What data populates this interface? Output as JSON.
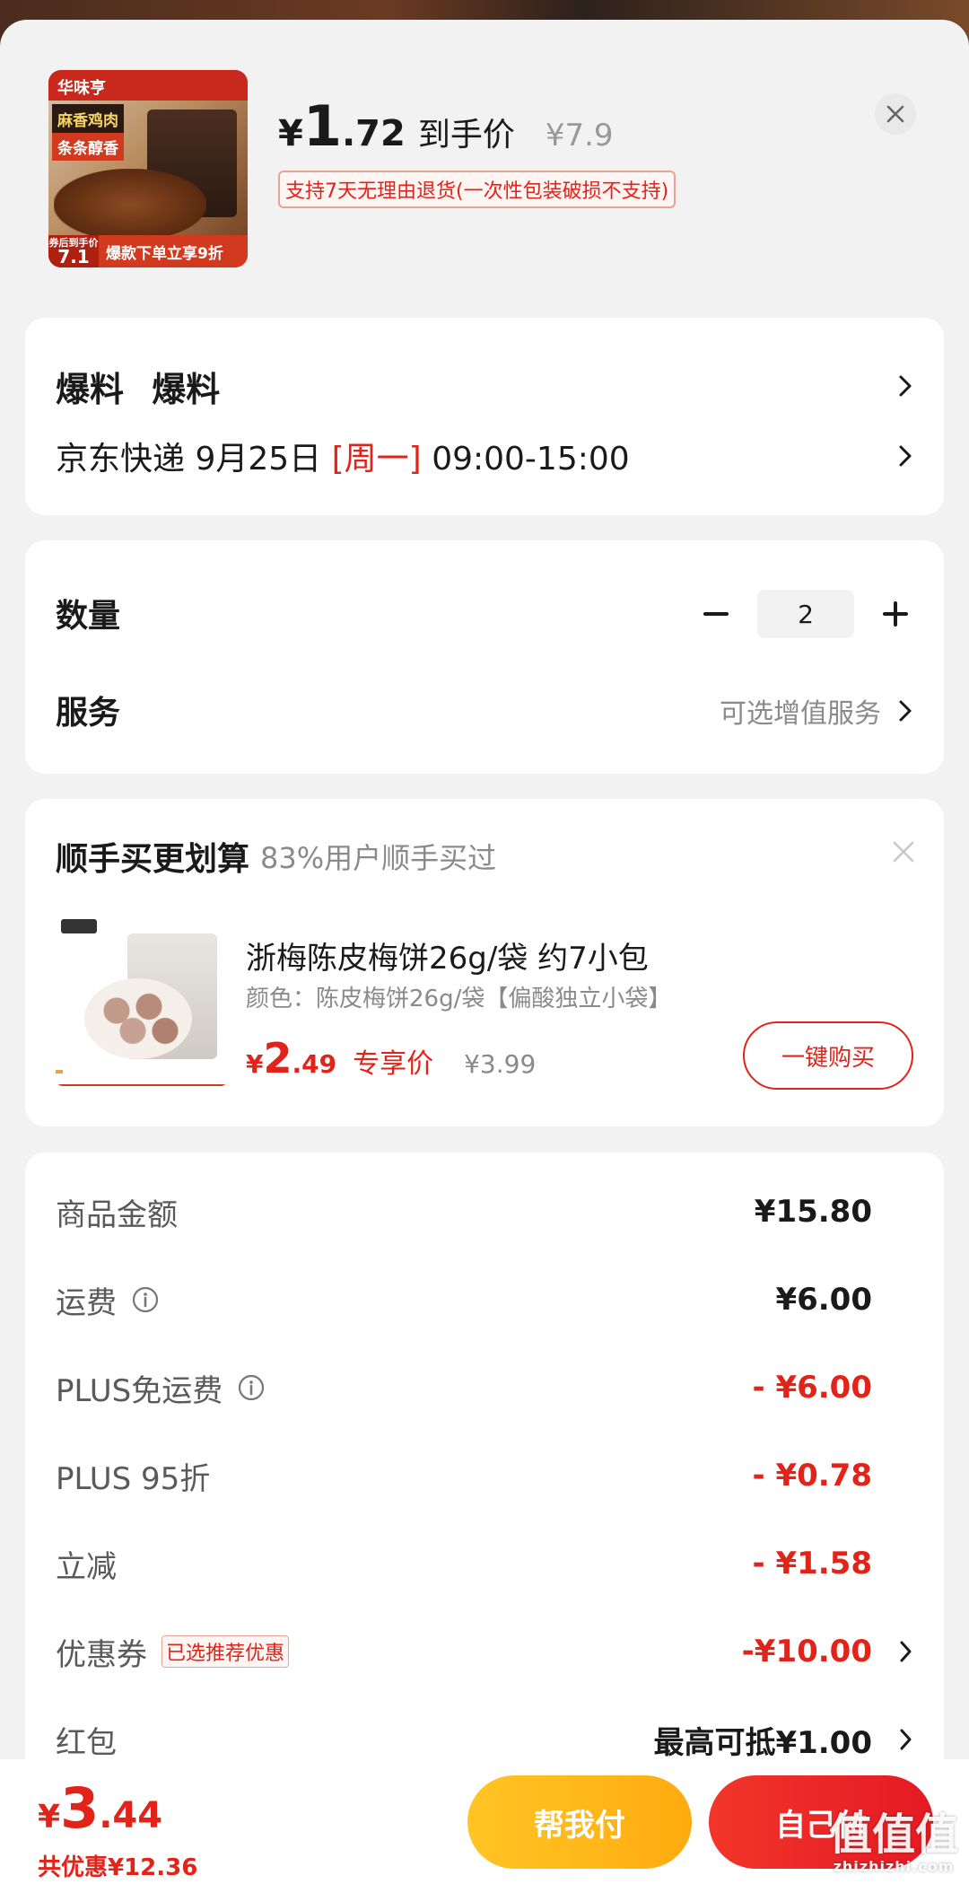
{
  "header": {
    "product_image": {
      "brand": "华味亨",
      "promo_line1": "麻香鸡肉",
      "promo_line2": "条条醇香",
      "badge_caption": "券后到手价",
      "badge_price": "7.1",
      "deal_text": "爆款下单立享9折"
    },
    "price_yen": "¥",
    "price_int": "1",
    "price_dec": ".72",
    "price_label": "到手价",
    "original_price": "¥7.9",
    "return_policy": "支持7天无理由退货(一次性包装破损不支持)"
  },
  "address": {
    "name": "爆料 爆料",
    "delivery_carrier": "京东快递",
    "delivery_date": "9月25日",
    "delivery_weekday": "[周一]",
    "delivery_time": "09:00-15:00"
  },
  "options": {
    "quantity_label": "数量",
    "quantity_value": "2",
    "minus_symbol": "−",
    "plus_symbol": "+",
    "service_label": "服务",
    "service_value": "可选增值服务"
  },
  "upsell": {
    "title": "顺手买更划算",
    "subtitle": "83%用户顺手买过",
    "product_name": "浙梅陈皮梅饼26g/袋 约7小包",
    "product_spec": "颜色：陈皮梅饼26g/袋【偏酸独立小袋】",
    "price_yen": "¥",
    "price_int": "2",
    "price_dec": ".49",
    "price_label": "专享价",
    "original_price": "¥3.99",
    "buy_button": "一键购买"
  },
  "fees": [
    {
      "label": "商品金额",
      "value": "¥15.80",
      "red": false,
      "info": false
    },
    {
      "label": "运费",
      "value": "¥6.00",
      "red": false,
      "info": true
    },
    {
      "label": "PLUS免运费",
      "value": "- ¥6.00",
      "red": true,
      "info": true
    },
    {
      "label": "PLUS 95折",
      "value": "- ¥0.78",
      "red": true,
      "info": false
    },
    {
      "label": "立减",
      "value": "- ¥1.58",
      "red": true,
      "info": false
    },
    {
      "label": "优惠券",
      "value": "-¥10.00",
      "red": true,
      "info": false,
      "tag": "已选推荐优惠",
      "chevron": true
    },
    {
      "label": "红包",
      "value": "最高可抵¥1.00",
      "red": false,
      "info": false,
      "chevron": true
    }
  ],
  "footer": {
    "total_yen": "¥",
    "total_int": "3",
    "total_dec": ".44",
    "saved_text": "共优惠¥12.36",
    "help_pay_button": "帮我付",
    "self_pay_button": "自己付"
  },
  "watermark": {
    "main": "值值值",
    "sub": "zhizhizhi.com"
  },
  "colors": {
    "accent_red": "#e2231a",
    "yellow_button": "#ffb81a",
    "background": "#f2f2f2"
  }
}
